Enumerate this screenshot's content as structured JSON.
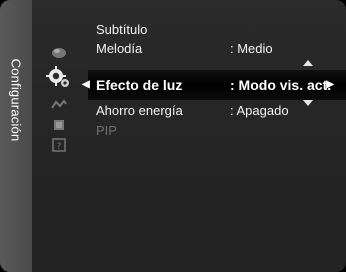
{
  "sidebar": {
    "section_label": "Configuración"
  },
  "menu": {
    "items": [
      {
        "label": "Subtítulo",
        "value": ""
      },
      {
        "label": "Melodía",
        "value": ": Medio"
      },
      {
        "label": "Efecto de luz",
        "value": ": Modo vis. act."
      },
      {
        "label": "Ahorro energía",
        "value": ": Apagado"
      },
      {
        "label": "PIP",
        "value": ""
      }
    ],
    "selected_index": 2
  },
  "icons": [
    "picture-icon",
    "settings-icon",
    "input-icon",
    "application-icon",
    "support-icon"
  ],
  "colors": {
    "highlight": "#000000",
    "text": "#f2f2f2",
    "disabled": "#6f6f6f"
  }
}
